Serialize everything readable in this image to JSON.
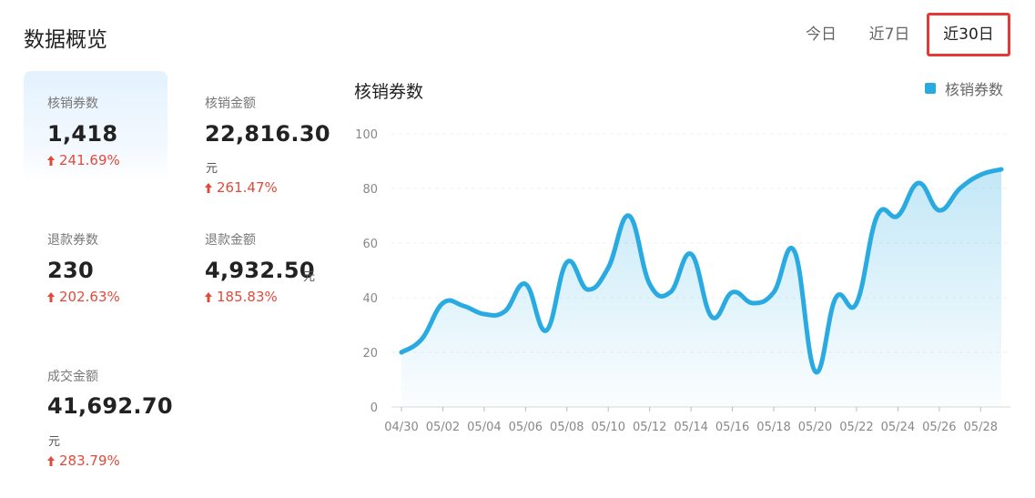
{
  "header": {
    "title": "数据概览"
  },
  "range_tabs": [
    {
      "label": "今日",
      "selected": false
    },
    {
      "label": "近7日",
      "selected": false
    },
    {
      "label": "近30日",
      "selected": true
    }
  ],
  "stats": {
    "verified_coupons": {
      "label": "核销券数",
      "value": "1,418",
      "change": "241.69%"
    },
    "verified_amount": {
      "label": "核销金额",
      "value": "22,816.30",
      "unit": "元",
      "change": "261.47%"
    },
    "refund_coupons": {
      "label": "退款券数",
      "value": "230",
      "change": "202.63%"
    },
    "refund_amount": {
      "label": "退款金额",
      "value": "4,932.50",
      "unit": "元",
      "change": "185.83%"
    },
    "deal_amount": {
      "label": "成交金额",
      "value": "41,692.70",
      "unit": "元",
      "change": "283.79%"
    }
  },
  "colors": {
    "accent": "#29abe2",
    "up": "#e04a3c",
    "selected_border": "#e53935"
  },
  "chart_data": {
    "type": "area",
    "title": "核销券数",
    "legend": [
      "核销券数"
    ],
    "legend_position": "top-right",
    "ylim": [
      0,
      100
    ],
    "yticks": [
      "0",
      "20",
      "40",
      "60",
      "80",
      "100"
    ],
    "xtick_labels": [
      "04/30",
      "05/02",
      "05/04",
      "05/06",
      "05/08",
      "05/10",
      "05/12",
      "05/14",
      "05/16",
      "05/18",
      "05/20",
      "05/22",
      "05/24",
      "05/26",
      "05/28"
    ],
    "grid": true,
    "series": [
      {
        "name": "核销券数",
        "x": [
          "04/30",
          "05/01",
          "05/02",
          "05/03",
          "05/04",
          "05/05",
          "05/06",
          "05/07",
          "05/08",
          "05/09",
          "05/10",
          "05/11",
          "05/12",
          "05/13",
          "05/14",
          "05/15",
          "05/16",
          "05/17",
          "05/18",
          "05/19",
          "05/20",
          "05/21",
          "05/22",
          "05/23",
          "05/24",
          "05/25",
          "05/26",
          "05/27",
          "05/28",
          "05/29"
        ],
        "values": [
          20,
          25,
          38,
          37,
          34,
          35,
          45,
          28,
          53,
          43,
          51,
          70,
          45,
          42,
          56,
          33,
          42,
          38,
          42,
          57,
          13,
          40,
          38,
          70,
          70,
          82,
          72,
          80,
          85,
          87
        ]
      }
    ]
  }
}
